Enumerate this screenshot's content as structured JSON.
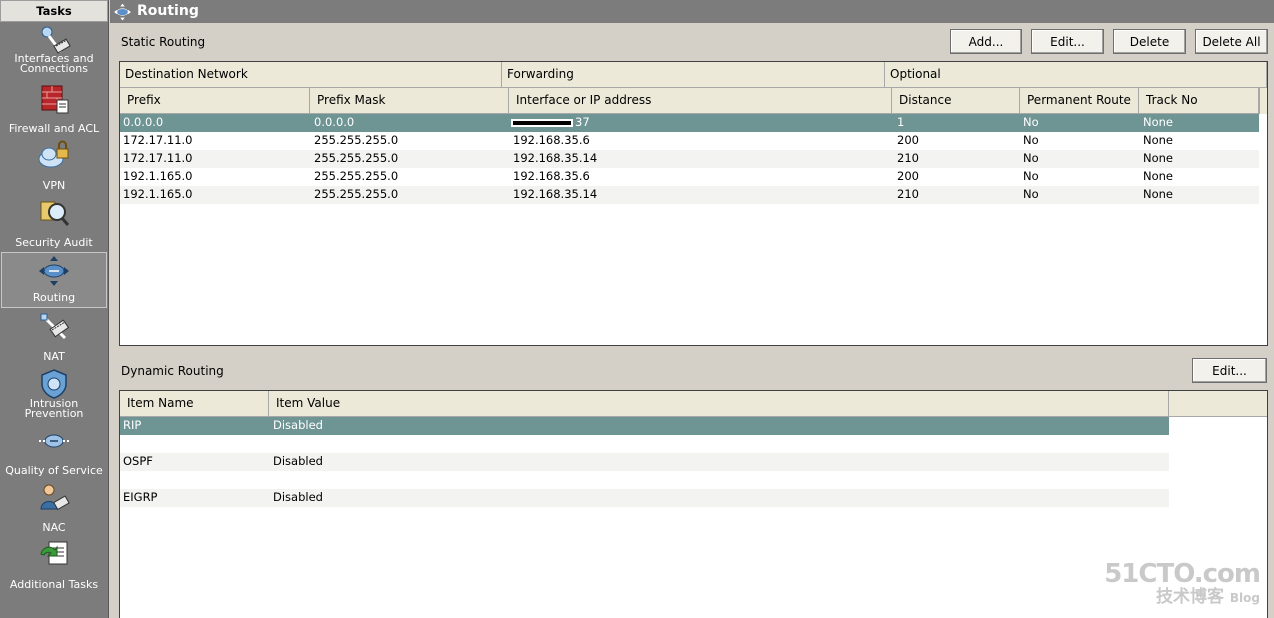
{
  "sidebar": {
    "header": "Tasks",
    "items": [
      {
        "label_l1": "Interfaces and",
        "label_l2": "Connections",
        "icon": "interfaces-icon"
      },
      {
        "label_l1": "Firewall and ACL",
        "label_l2": "",
        "icon": "firewall-icon"
      },
      {
        "label_l1": "VPN",
        "label_l2": "",
        "icon": "vpn-icon"
      },
      {
        "label_l1": "Security Audit",
        "label_l2": "",
        "icon": "security-audit-icon"
      },
      {
        "label_l1": "Routing",
        "label_l2": "",
        "icon": "routing-icon"
      },
      {
        "label_l1": "NAT",
        "label_l2": "",
        "icon": "nat-icon"
      },
      {
        "label_l1": "Intrusion Prevention",
        "label_l2": "",
        "icon": "intrusion-prevention-icon"
      },
      {
        "label_l1": "Quality of Service",
        "label_l2": "",
        "icon": "qos-icon"
      },
      {
        "label_l1": "NAC",
        "label_l2": "",
        "icon": "nac-icon"
      },
      {
        "label_l1": "Additional Tasks",
        "label_l2": "",
        "icon": "additional-tasks-icon"
      }
    ]
  },
  "title": "Routing",
  "static_routing": {
    "label": "Static Routing",
    "buttons": {
      "add": "Add...",
      "edit": "Edit...",
      "delete": "Delete",
      "delete_all": "Delete All"
    },
    "groups": {
      "destination": "Destination Network",
      "forwarding": "Forwarding",
      "optional": "Optional"
    },
    "columns": {
      "prefix": "Prefix",
      "mask": "Prefix Mask",
      "iface": "Interface or IP address",
      "distance": "Distance",
      "permanent": "Permanent Route",
      "track": "Track No"
    },
    "rows": [
      {
        "prefix": "0.0.0.0",
        "mask": "0.0.0.0",
        "iface": "37",
        "distance": "1",
        "permanent": "No",
        "track": "None"
      },
      {
        "prefix": "172.17.11.0",
        "mask": "255.255.255.0",
        "iface": "192.168.35.6",
        "distance": "200",
        "permanent": "No",
        "track": "None"
      },
      {
        "prefix": "172.17.11.0",
        "mask": "255.255.255.0",
        "iface": "192.168.35.14",
        "distance": "210",
        "permanent": "No",
        "track": "None"
      },
      {
        "prefix": "192.1.165.0",
        "mask": "255.255.255.0",
        "iface": "192.168.35.6",
        "distance": "200",
        "permanent": "No",
        "track": "None"
      },
      {
        "prefix": "192.1.165.0",
        "mask": "255.255.255.0",
        "iface": "192.168.35.14",
        "distance": "210",
        "permanent": "No",
        "track": "None"
      }
    ]
  },
  "dynamic_routing": {
    "label": "Dynamic Routing",
    "edit_button": "Edit...",
    "columns": {
      "name": "Item Name",
      "value": "Item Value"
    },
    "rows": [
      {
        "name": "RIP",
        "value": "Disabled"
      },
      {
        "name": "OSPF",
        "value": "Disabled"
      },
      {
        "name": "EIGRP",
        "value": "Disabled"
      }
    ]
  },
  "watermark": {
    "line1": "51CTO.com",
    "line2": "技术博客",
    "line3": "Blog"
  },
  "colors": {
    "selection": "#6e9494",
    "sidebar": "#7c7c7c",
    "panel": "#d4d0c8"
  }
}
